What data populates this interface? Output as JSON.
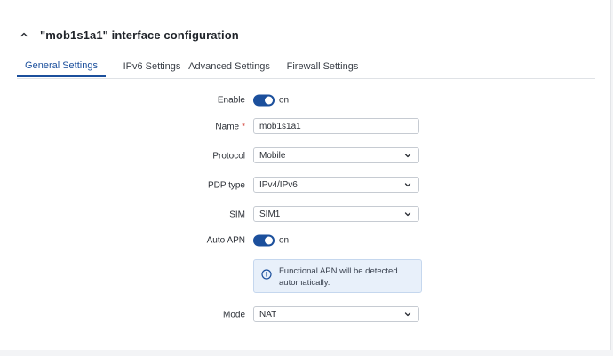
{
  "header": {
    "title": "\"mob1s1a1\" interface configuration"
  },
  "tabs": [
    {
      "label": "General Settings",
      "active": true
    },
    {
      "label": "IPv6 Settings",
      "active": false
    },
    {
      "label": "Advanced Settings",
      "active": false
    },
    {
      "label": "Firewall Settings",
      "active": false
    }
  ],
  "form": {
    "enable": {
      "label": "Enable",
      "state": "on"
    },
    "name": {
      "label": "Name",
      "required_mark": "*",
      "value": "mob1s1a1"
    },
    "protocol": {
      "label": "Protocol",
      "value": "Mobile"
    },
    "pdp_type": {
      "label": "PDP type",
      "value": "IPv4/IPv6"
    },
    "sim": {
      "label": "SIM",
      "value": "SIM1"
    },
    "auto_apn": {
      "label": "Auto APN",
      "state": "on"
    },
    "info": {
      "text": "Functional APN will be detected automatically.",
      "icon": "info-icon"
    },
    "mode": {
      "label": "Mode",
      "value": "NAT"
    }
  },
  "colors": {
    "accent": "#1b4f9c",
    "info_bg": "#e8f0fa",
    "required": "#d0342c"
  }
}
